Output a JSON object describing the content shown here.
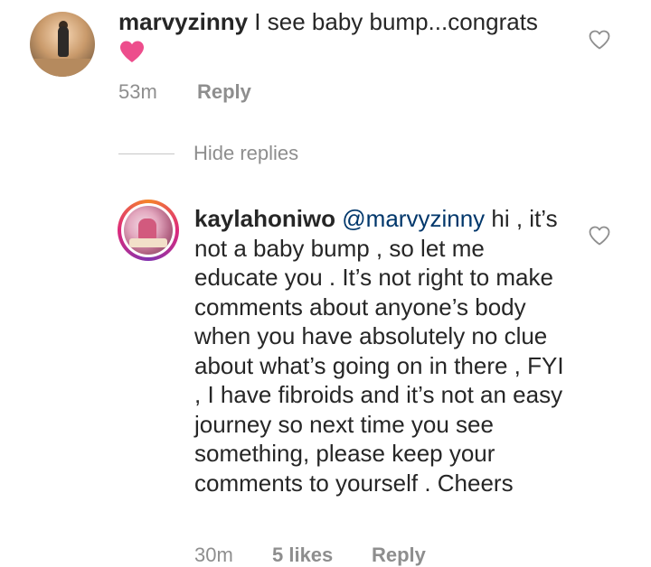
{
  "comments": [
    {
      "username": "marvyzinny",
      "text": " I see baby bump...congrats",
      "emoji": "❤",
      "time": "53m",
      "reply_label": "Reply"
    }
  ],
  "replies_toggle": {
    "label": "Hide replies"
  },
  "reply": {
    "username": "kaylahoniwo",
    "mention": "@marvyzinny",
    "text": "hi , it’s not a baby bump , so let me educate you . It’s not right to make comments about anyone’s body when you have absolutely no clue about what’s going on in there , FYI , I have fibroids and it’s not an easy journey so next time you see something, please keep your comments to yourself . Cheers",
    "time": "30m",
    "likes": "5 likes",
    "reply_label": "Reply"
  },
  "icons": {
    "like": "heart-outline-icon",
    "emoji_heart_color": "#ed4d8c"
  },
  "colors": {
    "text": "#262626",
    "meta": "#8e8e8e",
    "mention": "#00376b"
  }
}
